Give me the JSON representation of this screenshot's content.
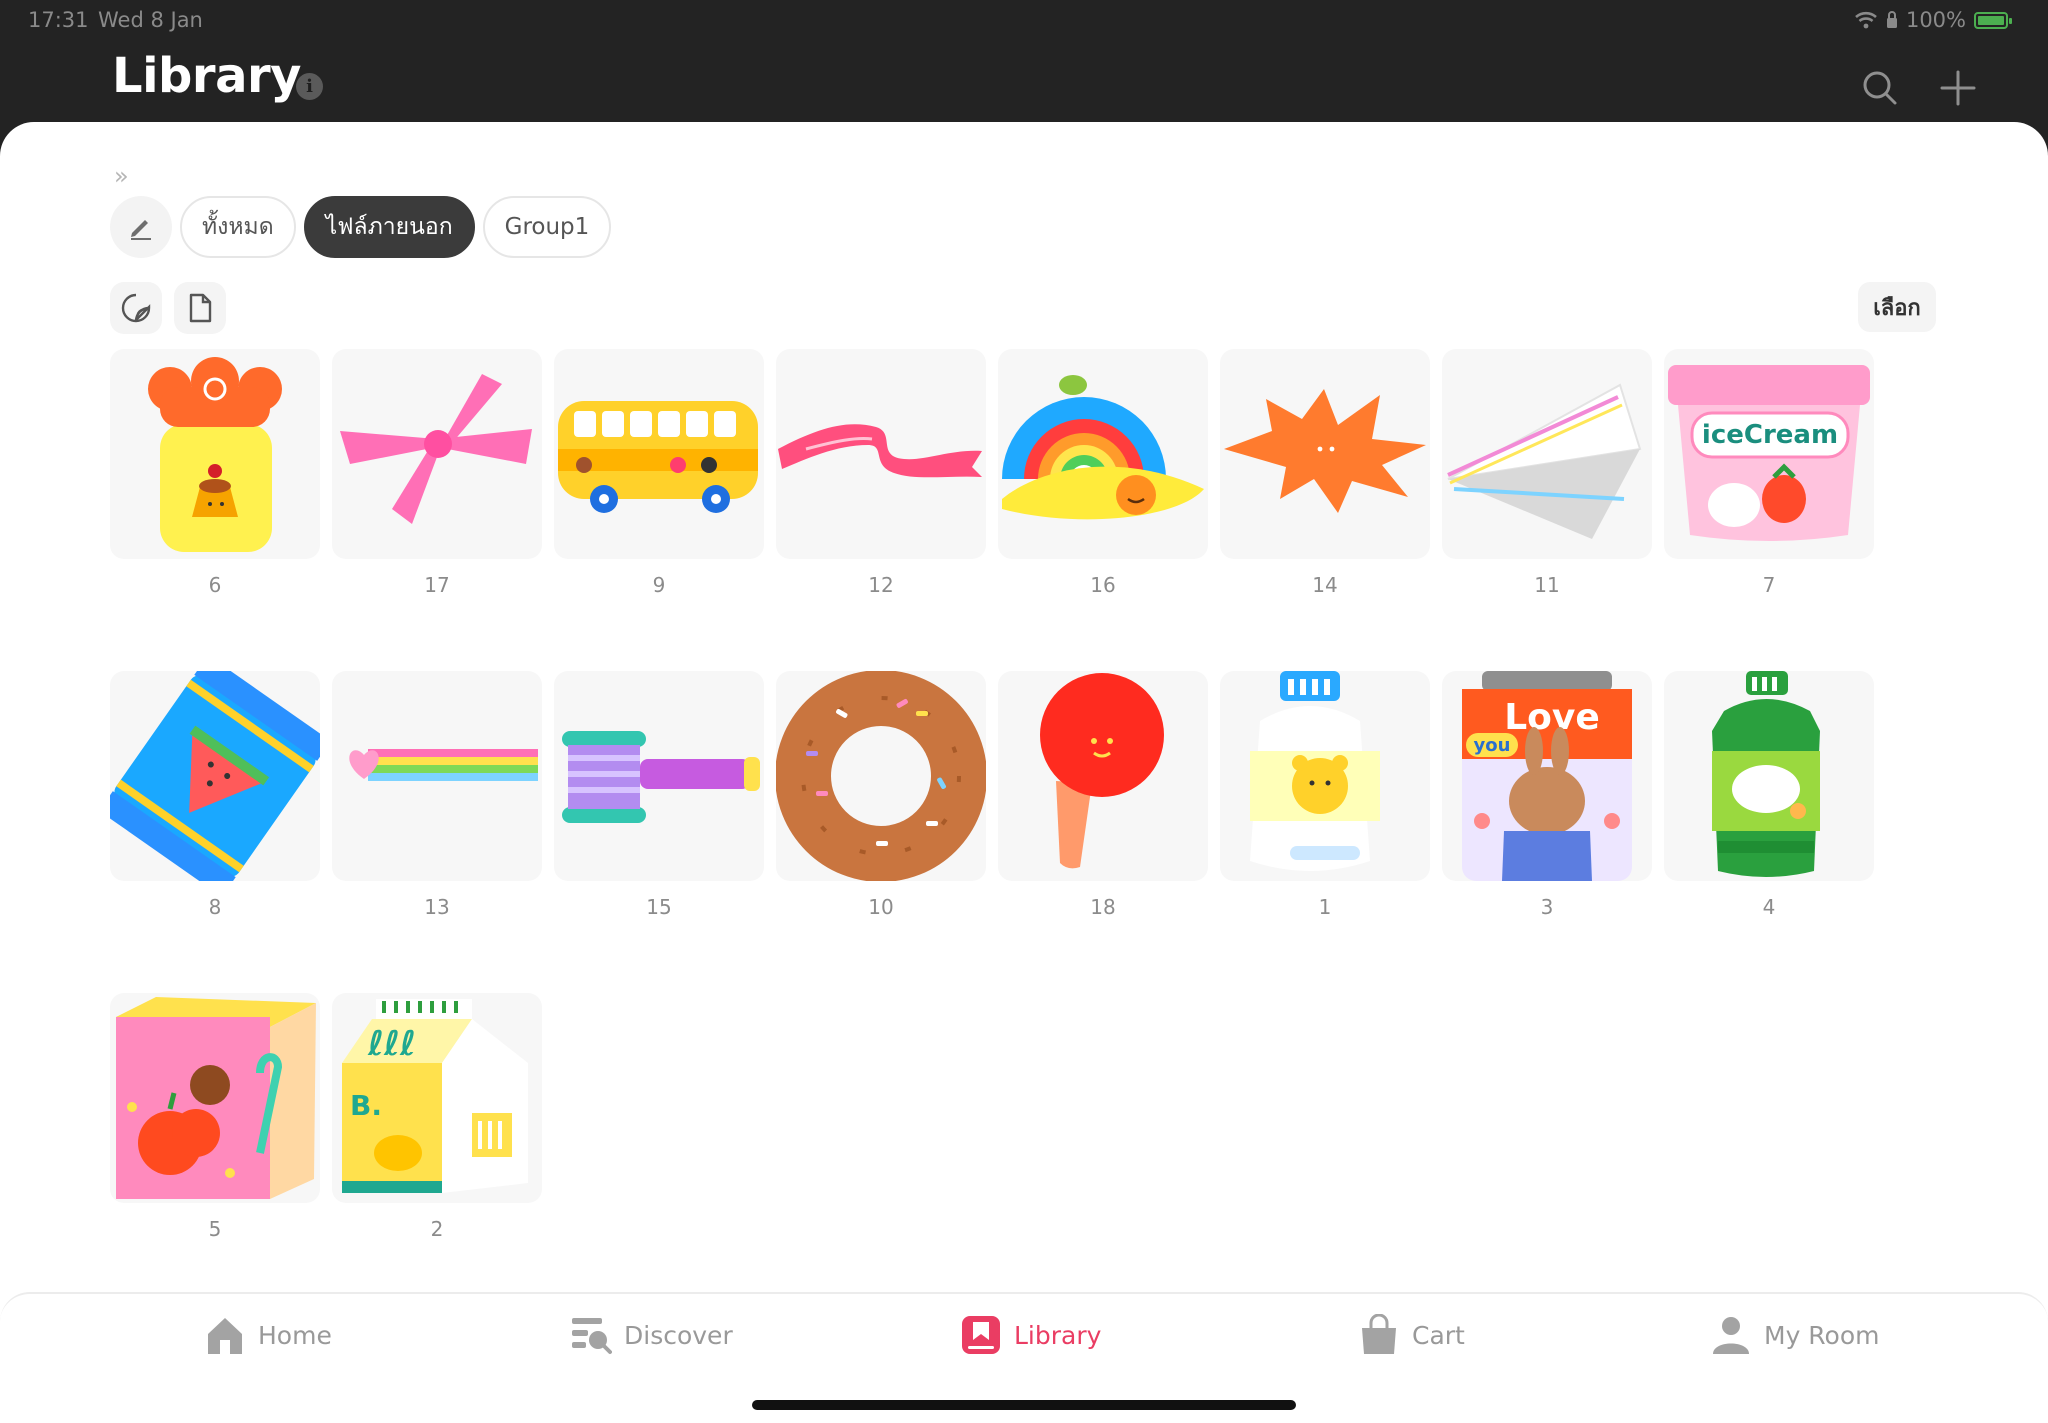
{
  "status_bar": {
    "time": "17:31",
    "date": "Wed 8 Jan",
    "battery": "100%"
  },
  "header": {
    "title": "Library"
  },
  "filters": {
    "chips": [
      {
        "label": "ทั้งหมด",
        "active": false
      },
      {
        "label": "ไฟล์ภายนอก",
        "active": true
      },
      {
        "label": "Group1",
        "active": false
      }
    ]
  },
  "select_label": "เลือก",
  "stickers": [
    {
      "label": "6",
      "icon": "pudding-jar-icon"
    },
    {
      "label": "17",
      "icon": "pink-bow-icon"
    },
    {
      "label": "9",
      "icon": "yellow-bus-icon"
    },
    {
      "label": "12",
      "icon": "pink-ribbon-icon"
    },
    {
      "label": "16",
      "icon": "rainbow-icon"
    },
    {
      "label": "14",
      "icon": "orange-splash-icon"
    },
    {
      "label": "11",
      "icon": "paper-plane-icon"
    },
    {
      "label": "7",
      "icon": "ice-cream-cup-icon"
    },
    {
      "label": "8",
      "icon": "watermelon-candy-icon"
    },
    {
      "label": "13",
      "icon": "heart-rainbow-trail-icon"
    },
    {
      "label": "15",
      "icon": "ribbon-spool-icon"
    },
    {
      "label": "10",
      "icon": "donut-icon"
    },
    {
      "label": "18",
      "icon": "lollipop-icon"
    },
    {
      "label": "1",
      "icon": "milk-bottle-icon"
    },
    {
      "label": "3",
      "icon": "love-you-jar-icon"
    },
    {
      "label": "4",
      "icon": "green-bottle-icon"
    },
    {
      "label": "5",
      "icon": "juice-box-icon"
    },
    {
      "label": "2",
      "icon": "milk-carton-icon"
    }
  ],
  "ice_cream_text": "iceCream",
  "love_text": "Love",
  "you_text": "you",
  "carton_text": "B.",
  "tabs": [
    {
      "label": "Home",
      "icon": "home-icon",
      "active": false
    },
    {
      "label": "Discover",
      "icon": "discover-icon",
      "active": false
    },
    {
      "label": "Library",
      "icon": "library-icon",
      "active": true
    },
    {
      "label": "Cart",
      "icon": "cart-icon",
      "active": false
    },
    {
      "label": "My Room",
      "icon": "my-room-icon",
      "active": false
    }
  ],
  "colors": {
    "accent": "#ea3d63",
    "header_bg": "#232323",
    "chip_active": "#3b3b3b"
  }
}
